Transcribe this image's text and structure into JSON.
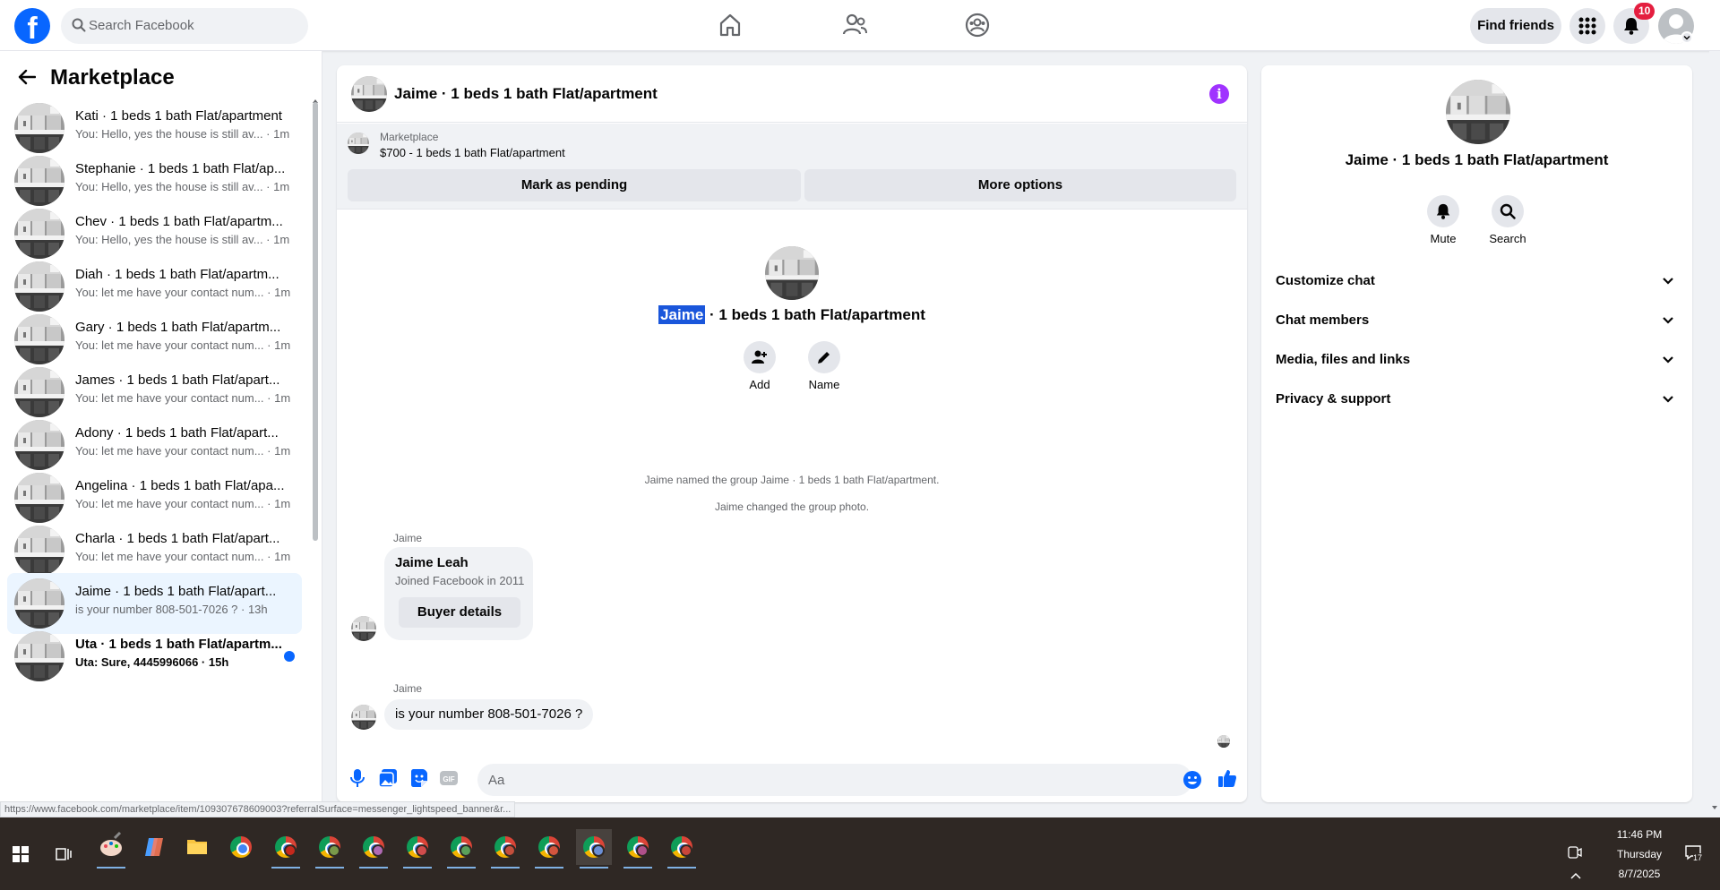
{
  "topbar": {
    "search_placeholder": "Search Facebook",
    "find_friends": "Find friends",
    "notification_count": "10"
  },
  "sidebar": {
    "title": "Marketplace",
    "conversations": [
      {
        "name": "Kati · 1 beds 1 bath Flat/apartment",
        "preview": "You: Hello, yes the house is still av...",
        "time": " · 1m"
      },
      {
        "name": "Stephanie · 1 beds 1 bath Flat/ap...",
        "preview": "You: Hello, yes the house is still av...",
        "time": " · 1m"
      },
      {
        "name": "Chev · 1 beds 1 bath Flat/apartm...",
        "preview": "You: Hello, yes the house is still av...",
        "time": " · 1m"
      },
      {
        "name": "Diah · 1 beds 1 bath Flat/apartm...",
        "preview": "You: let me have your contact num...",
        "time": " · 1m"
      },
      {
        "name": "Gary · 1 beds 1 bath Flat/apartm...",
        "preview": "You: let me have your contact num...",
        "time": " · 1m"
      },
      {
        "name": "James · 1 beds 1 bath Flat/apart...",
        "preview": "You: let me have your contact num...",
        "time": " · 1m"
      },
      {
        "name": "Adony · 1 beds 1 bath Flat/apart...",
        "preview": "You: let me have your contact num...",
        "time": " · 1m"
      },
      {
        "name": "Angelina · 1 beds 1 bath Flat/apa...",
        "preview": "You: let me have your contact num...",
        "time": " · 1m"
      },
      {
        "name": "Charla · 1 beds 1 bath Flat/apart...",
        "preview": "You: let me have your contact num...",
        "time": " · 1m"
      },
      {
        "name": "Jaime · 1 beds 1 bath Flat/apart...",
        "preview": "is your number 808-501-7026 ?",
        "time": " · 13h"
      },
      {
        "name": "Uta · 1 beds 1 bath Flat/apartm...",
        "preview": "Uta: Sure, 4445996066",
        "time": " · 15h"
      }
    ]
  },
  "chat": {
    "title": "Jaime · 1 beds 1 bath Flat/apartment",
    "listing_source": "Marketplace",
    "listing_item": "$700 - 1 beds 1 bath Flat/apartment",
    "mark_pending": "Mark as pending",
    "more_options": "More options",
    "group_name_highlight": "Jaime",
    "group_name_rest": " · 1 beds 1 bath Flat/apartment",
    "add_label": "Add",
    "name_label": "Name",
    "sys_msg_1": "Jaime named the group Jaime · 1 beds 1 bath Flat/apartment.",
    "sys_msg_2": "Jaime changed the group photo.",
    "sender_1": "Jaime",
    "card_name": "Jaime Leah",
    "card_joined": "Joined Facebook in 2011",
    "card_button": "Buyer details",
    "sender_2": "Jaime",
    "message": "is your number 808-501-7026 ?",
    "composer_placeholder": "Aa"
  },
  "right_panel": {
    "name": "Jaime · 1 beds 1 bath Flat/apartment",
    "mute": "Mute",
    "search": "Search",
    "sections": [
      "Customize chat",
      "Chat members",
      "Media, files and links",
      "Privacy & support"
    ]
  },
  "status_url": "https://www.facebook.com/marketplace/item/109307678609003?referralSurface=messenger_lightspeed_banner&r...",
  "taskbar": {
    "time": "11:46 PM",
    "day": "Thursday",
    "date": "8/7/2025",
    "notif_count": "17"
  },
  "colors": {
    "brand": "#0866ff",
    "info": "#a033ff",
    "badge": "#e41e3f",
    "active_row": "#ebf5ff"
  }
}
